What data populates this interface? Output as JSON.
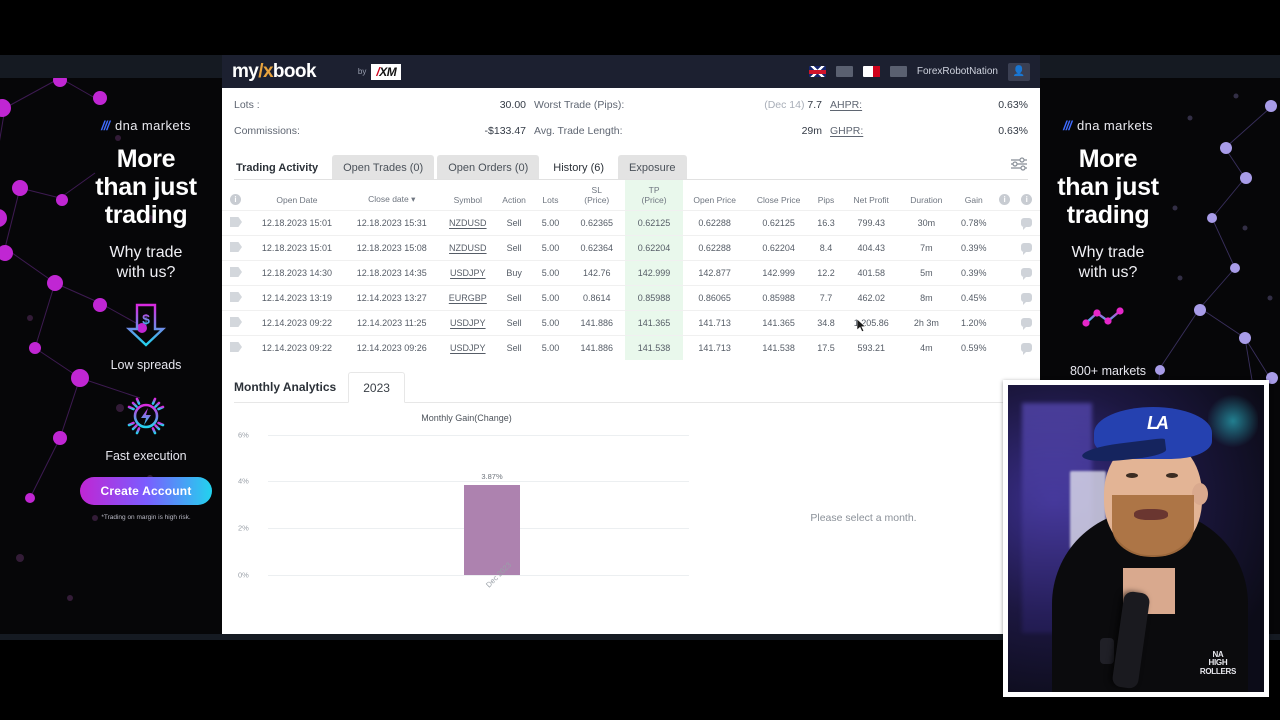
{
  "site": {
    "logo_my": "my",
    "logo_slash": "/",
    "logo_x": "x",
    "logo_book": "book",
    "by": "by",
    "broker": "XM",
    "broker_r": "/",
    "username": "ForexRobotNation"
  },
  "stats": [
    {
      "label": "Lots :",
      "value": "30.00",
      "label2": "Worst Trade (Pips):",
      "value2_muted": "(Dec 14)",
      "value2": "7.7",
      "label3": "AHPR:",
      "value3": "0.63%"
    },
    {
      "label": "Commissions:",
      "value": "-$133.47",
      "label2": "Avg. Trade Length:",
      "value2_muted": "",
      "value2": "29m",
      "label3": "GHPR:",
      "value3": "0.63%"
    }
  ],
  "tabs": [
    {
      "label": "Trading Activity",
      "style": "first"
    },
    {
      "label": "Open Trades (0)",
      "style": "plain"
    },
    {
      "label": "Open Orders (0)",
      "style": "plain"
    },
    {
      "label": "History (6)",
      "style": "active"
    },
    {
      "label": "Exposure",
      "style": "plain"
    }
  ],
  "table": {
    "headers": [
      "",
      "Open Date",
      "Close date ▾",
      "Symbol",
      "Action",
      "Lots",
      "SL\n(Price)",
      "TP\n(Price)",
      "Open Price",
      "Close Price",
      "Pips",
      "Net Profit",
      "Duration",
      "Gain",
      "",
      ""
    ],
    "header_sl_top": "SL",
    "header_sl_bot": "(Price)",
    "header_tp_top": "TP",
    "header_tp_bot": "(Price)",
    "rows": [
      {
        "open_date": "12.18.2023 15:01",
        "close_date": "12.18.2023 15:31",
        "symbol": "NZDUSD",
        "action": "Sell",
        "lots": "5.00",
        "sl": "0.62365",
        "tp": "0.62125",
        "open_price": "0.62288",
        "close_price": "0.62125",
        "pips": "16.3",
        "net_profit": "799.43",
        "duration": "30m",
        "gain": "0.78%"
      },
      {
        "open_date": "12.18.2023 15:01",
        "close_date": "12.18.2023 15:08",
        "symbol": "NZDUSD",
        "action": "Sell",
        "lots": "5.00",
        "sl": "0.62364",
        "tp": "0.62204",
        "open_price": "0.62288",
        "close_price": "0.62204",
        "pips": "8.4",
        "net_profit": "404.43",
        "duration": "7m",
        "gain": "0.39%"
      },
      {
        "open_date": "12.18.2023 14:30",
        "close_date": "12.18.2023 14:35",
        "symbol": "USDJPY",
        "action": "Buy",
        "lots": "5.00",
        "sl": "142.76",
        "tp": "142.999",
        "open_price": "142.877",
        "close_price": "142.999",
        "pips": "12.2",
        "net_profit": "401.58",
        "duration": "5m",
        "gain": "0.39%"
      },
      {
        "open_date": "12.14.2023 13:19",
        "close_date": "12.14.2023 13:27",
        "symbol": "EURGBP",
        "action": "Sell",
        "lots": "5.00",
        "sl": "0.8614",
        "tp": "0.85988",
        "open_price": "0.86065",
        "close_price": "0.85988",
        "pips": "7.7",
        "net_profit": "462.02",
        "duration": "8m",
        "gain": "0.45%"
      },
      {
        "open_date": "12.14.2023 09:22",
        "close_date": "12.14.2023 11:25",
        "symbol": "USDJPY",
        "action": "Sell",
        "lots": "5.00",
        "sl": "141.886",
        "tp": "141.365",
        "open_price": "141.713",
        "close_price": "141.365",
        "pips": "34.8",
        "net_profit": "1,205.86",
        "duration": "2h 3m",
        "gain": "1.20%"
      },
      {
        "open_date": "12.14.2023 09:22",
        "close_date": "12.14.2023 09:26",
        "symbol": "USDJPY",
        "action": "Sell",
        "lots": "5.00",
        "sl": "141.886",
        "tp": "141.538",
        "open_price": "141.713",
        "close_price": "141.538",
        "pips": "17.5",
        "net_profit": "593.21",
        "duration": "4m",
        "gain": "0.59%"
      }
    ]
  },
  "monthly": {
    "title": "Monthly Analytics",
    "year": "2023",
    "empty_message": "Please select a month."
  },
  "chart_data": {
    "type": "bar",
    "title": "Monthly Gain(Change)",
    "categories": [
      "Dec 2023"
    ],
    "values": [
      3.87
    ],
    "value_labels": [
      "3.87%"
    ],
    "ytick_labels": [
      "6%",
      "4%",
      "2%",
      "0%"
    ],
    "ytick_values": [
      6,
      4,
      2,
      0
    ],
    "ylim": [
      0,
      6
    ],
    "xlabel": "",
    "ylabel": "",
    "grid": true,
    "legend": "none",
    "bar_color": "#ad82af"
  },
  "ads": {
    "left": {
      "brand": "dna markets",
      "headline": "More\nthan just\ntrading",
      "headline_l1": "More",
      "headline_l2": "than just",
      "headline_l3": "trading",
      "sub_l1": "Why trade",
      "sub_l2": "with us?",
      "feature1": "Low spreads",
      "feature2": "Fast execution",
      "cta": "Create Account",
      "disclaimer": "*Trading on margin is high risk."
    },
    "right": {
      "brand": "dna markets",
      "headline_l1": "More",
      "headline_l2": "than just",
      "headline_l3": "trading",
      "sub_l1": "Why trade",
      "sub_l2": "with us?",
      "feature1": "800+ markets"
    }
  },
  "colors": {
    "accent_green": "#27b463",
    "tp_highlight": "#e9f8ec",
    "bar_purple": "#ad82af",
    "header_dark": "#1c2030"
  }
}
